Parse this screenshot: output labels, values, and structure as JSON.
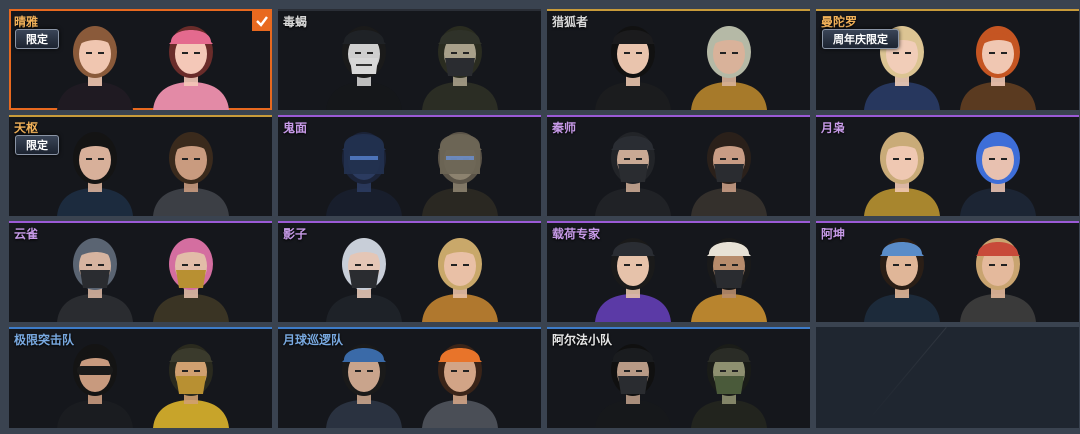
{
  "cards": [
    {
      "name": "晴雅",
      "tag": "限定",
      "selected": true,
      "accent": "#e8691f",
      "namecolor": "#f2b25a",
      "portraits": [
        {
          "hair": "#8a5a3a",
          "skin": "#f0c6b0",
          "mask": "none",
          "outfit": "#1f1a22",
          "hat": "none"
        },
        {
          "hair": "#6a2c2a",
          "skin": "#f4c8b8",
          "mask": "none",
          "outfit": "#e38aa6",
          "hat": "#e46a8e"
        }
      ]
    },
    {
      "name": "毒蝎",
      "tag": "",
      "selected": false,
      "accent": "#2a2e36",
      "namecolor": "#d7d7d7",
      "portraits": [
        {
          "hair": "#1a1a1a",
          "skin": "#cfcfcf",
          "mask": "skull",
          "outfit": "#15171a",
          "hat": "#1f2226"
        },
        {
          "hair": "#2a2c20",
          "skin": "#a8a08a",
          "mask": "cloth",
          "outfit": "#2b2d24",
          "hat": "#2f3229"
        }
      ]
    },
    {
      "name": "猎狐者",
      "tag": "",
      "selected": false,
      "accent": "#c89b3a",
      "namecolor": "#d7d7d7",
      "portraits": [
        {
          "hair": "#111111",
          "skin": "#e9c4ad",
          "mask": "none",
          "outfit": "#1b1c1e",
          "hat": "#1b1b1d"
        },
        {
          "hair": "#b5b9a6",
          "skin": "#d9b29a",
          "mask": "none",
          "outfit": "#a77a2a",
          "hat": "none"
        }
      ]
    },
    {
      "name": "曼陀罗",
      "tag": "周年庆限定",
      "selected": false,
      "accent": "#c89b3a",
      "namecolor": "#f2b25a",
      "portraits": [
        {
          "hair": "#dcc493",
          "skin": "#f1cdb8",
          "mask": "none",
          "outfit": "#27375e",
          "hat": "none"
        },
        {
          "hair": "#c55522",
          "skin": "#f0c7b2",
          "mask": "none",
          "outfit": "#5a3a20",
          "hat": "none"
        }
      ]
    },
    {
      "name": "天枢",
      "tag": "限定",
      "selected": false,
      "accent": "#c89b3a",
      "namecolor": "#f2b25a",
      "portraits": [
        {
          "hair": "#141414",
          "skin": "#d8b09a",
          "mask": "none",
          "outfit": "#1c2b3e",
          "hat": "none"
        },
        {
          "hair": "#3a2a1c",
          "skin": "#c99b7f",
          "mask": "none",
          "outfit": "#3c3f45",
          "hat": "none"
        }
      ]
    },
    {
      "name": "鬼面",
      "tag": "",
      "selected": false,
      "accent": "#9b5ad6",
      "namecolor": "#c79ae8",
      "portraits": [
        {
          "hair": "#1b2338",
          "skin": "#2b3b60",
          "mask": "helmet",
          "outfit": "#181e2c",
          "hat": "#22304e"
        },
        {
          "hair": "#5b5448",
          "skin": "#8c826f",
          "mask": "helmet",
          "outfit": "#2a2822",
          "hat": "#6d6555"
        }
      ]
    },
    {
      "name": "秦师",
      "tag": "",
      "selected": false,
      "accent": "#9b5ad6",
      "namecolor": "#c79ae8",
      "portraits": [
        {
          "hair": "#222428",
          "skin": "#c9a994",
          "mask": "cloth",
          "outfit": "#202226",
          "hat": "#2a2d33"
        },
        {
          "hair": "#2a201a",
          "skin": "#c89c84",
          "mask": "cloth",
          "outfit": "#34302c",
          "hat": "none"
        }
      ]
    },
    {
      "name": "月枭",
      "tag": "",
      "selected": false,
      "accent": "#9b5ad6",
      "namecolor": "#c79ae8",
      "portraits": [
        {
          "hair": "#c9ab78",
          "skin": "#efc8b2",
          "mask": "none",
          "outfit": "#a8862e",
          "hat": "none"
        },
        {
          "hair": "#3e6ed8",
          "skin": "#e8c1b0",
          "mask": "none",
          "outfit": "#1c2534",
          "hat": "none"
        }
      ]
    },
    {
      "name": "云雀",
      "tag": "",
      "selected": false,
      "accent": "#9b5ad6",
      "namecolor": "#c79ae8",
      "portraits": [
        {
          "hair": "#5a6472",
          "skin": "#d6b4a0",
          "mask": "cloth",
          "outfit": "#2a2c30",
          "hat": "none"
        },
        {
          "hair": "#d46ea0",
          "skin": "#e2bca8",
          "mask": "gold",
          "outfit": "#3a3424",
          "hat": "none"
        }
      ]
    },
    {
      "name": "影子",
      "tag": "",
      "selected": false,
      "accent": "#9b5ad6",
      "namecolor": "#c79ae8",
      "portraits": [
        {
          "hair": "#c8ced8",
          "skin": "#e4c6b6",
          "mask": "cloth",
          "outfit": "#1e2228",
          "hat": "none"
        },
        {
          "hair": "#c9a86a",
          "skin": "#e9c0a6",
          "mask": "none",
          "outfit": "#b0782e",
          "hat": "none"
        }
      ]
    },
    {
      "name": "载荷专家",
      "tag": "",
      "selected": false,
      "accent": "#9b5ad6",
      "namecolor": "#c79ae8",
      "portraits": [
        {
          "hair": "#1a1a1a",
          "skin": "#e6c2aa",
          "mask": "none",
          "outfit": "#5b3aa6",
          "hat": "#2a2d33"
        },
        {
          "hair": "#1a1a1a",
          "skin": "#b78c6c",
          "mask": "cloth",
          "outfit": "#b8842e",
          "hat": "#e8e2d6"
        }
      ]
    },
    {
      "name": "阿坤",
      "tag": "",
      "selected": false,
      "accent": "#9b5ad6",
      "namecolor": "#c79ae8",
      "portraits": [
        {
          "hair": "#2a1e16",
          "skin": "#e0b698",
          "mask": "none",
          "outfit": "#1c2a3a",
          "hat": "#5a8cc8"
        },
        {
          "hair": "#c9a470",
          "skin": "#e4b99c",
          "mask": "none",
          "outfit": "#3a3a3a",
          "hat": "#c84a3a"
        }
      ]
    },
    {
      "name": "极限突击队",
      "tag": "",
      "selected": false,
      "accent": "#3d7cc9",
      "namecolor": "#79a9e0",
      "portraits": [
        {
          "hair": "#141414",
          "skin": "#c89a7e",
          "mask": "goggles",
          "outfit": "#1a1c20",
          "hat": "none"
        },
        {
          "hair": "#2a2a1e",
          "skin": "#d0a070",
          "mask": "gold",
          "outfit": "#c8a42a",
          "hat": "#3a3a2c"
        }
      ]
    },
    {
      "name": "月球巡逻队",
      "tag": "",
      "selected": false,
      "accent": "#3d7cc9",
      "namecolor": "#79a9e0",
      "portraits": [
        {
          "hair": "#1a1a1a",
          "skin": "#c9a48c",
          "mask": "none",
          "outfit": "#2a3240",
          "hat": "#3a6aa8"
        },
        {
          "hair": "#3a2418",
          "skin": "#d2a486",
          "mask": "none",
          "outfit": "#4a4e56",
          "hat": "#e8742a"
        }
      ]
    },
    {
      "name": "阿尔法小队",
      "tag": "",
      "selected": false,
      "accent": "#3d7cc9",
      "namecolor": "#e6e6e6",
      "portraits": [
        {
          "hair": "#101010",
          "skin": "#b89a86",
          "mask": "balaclava",
          "outfit": "#16181b",
          "hat": "#1a1c1f"
        },
        {
          "hair": "#1a1c18",
          "skin": "#8e9070",
          "mask": "camo",
          "outfit": "#22241e",
          "hat": "#2a2c26"
        }
      ]
    },
    {
      "name": "",
      "tag": "",
      "selected": false,
      "empty": true,
      "accent": "#1f2630",
      "namecolor": "#ffffff",
      "portraits": []
    }
  ]
}
